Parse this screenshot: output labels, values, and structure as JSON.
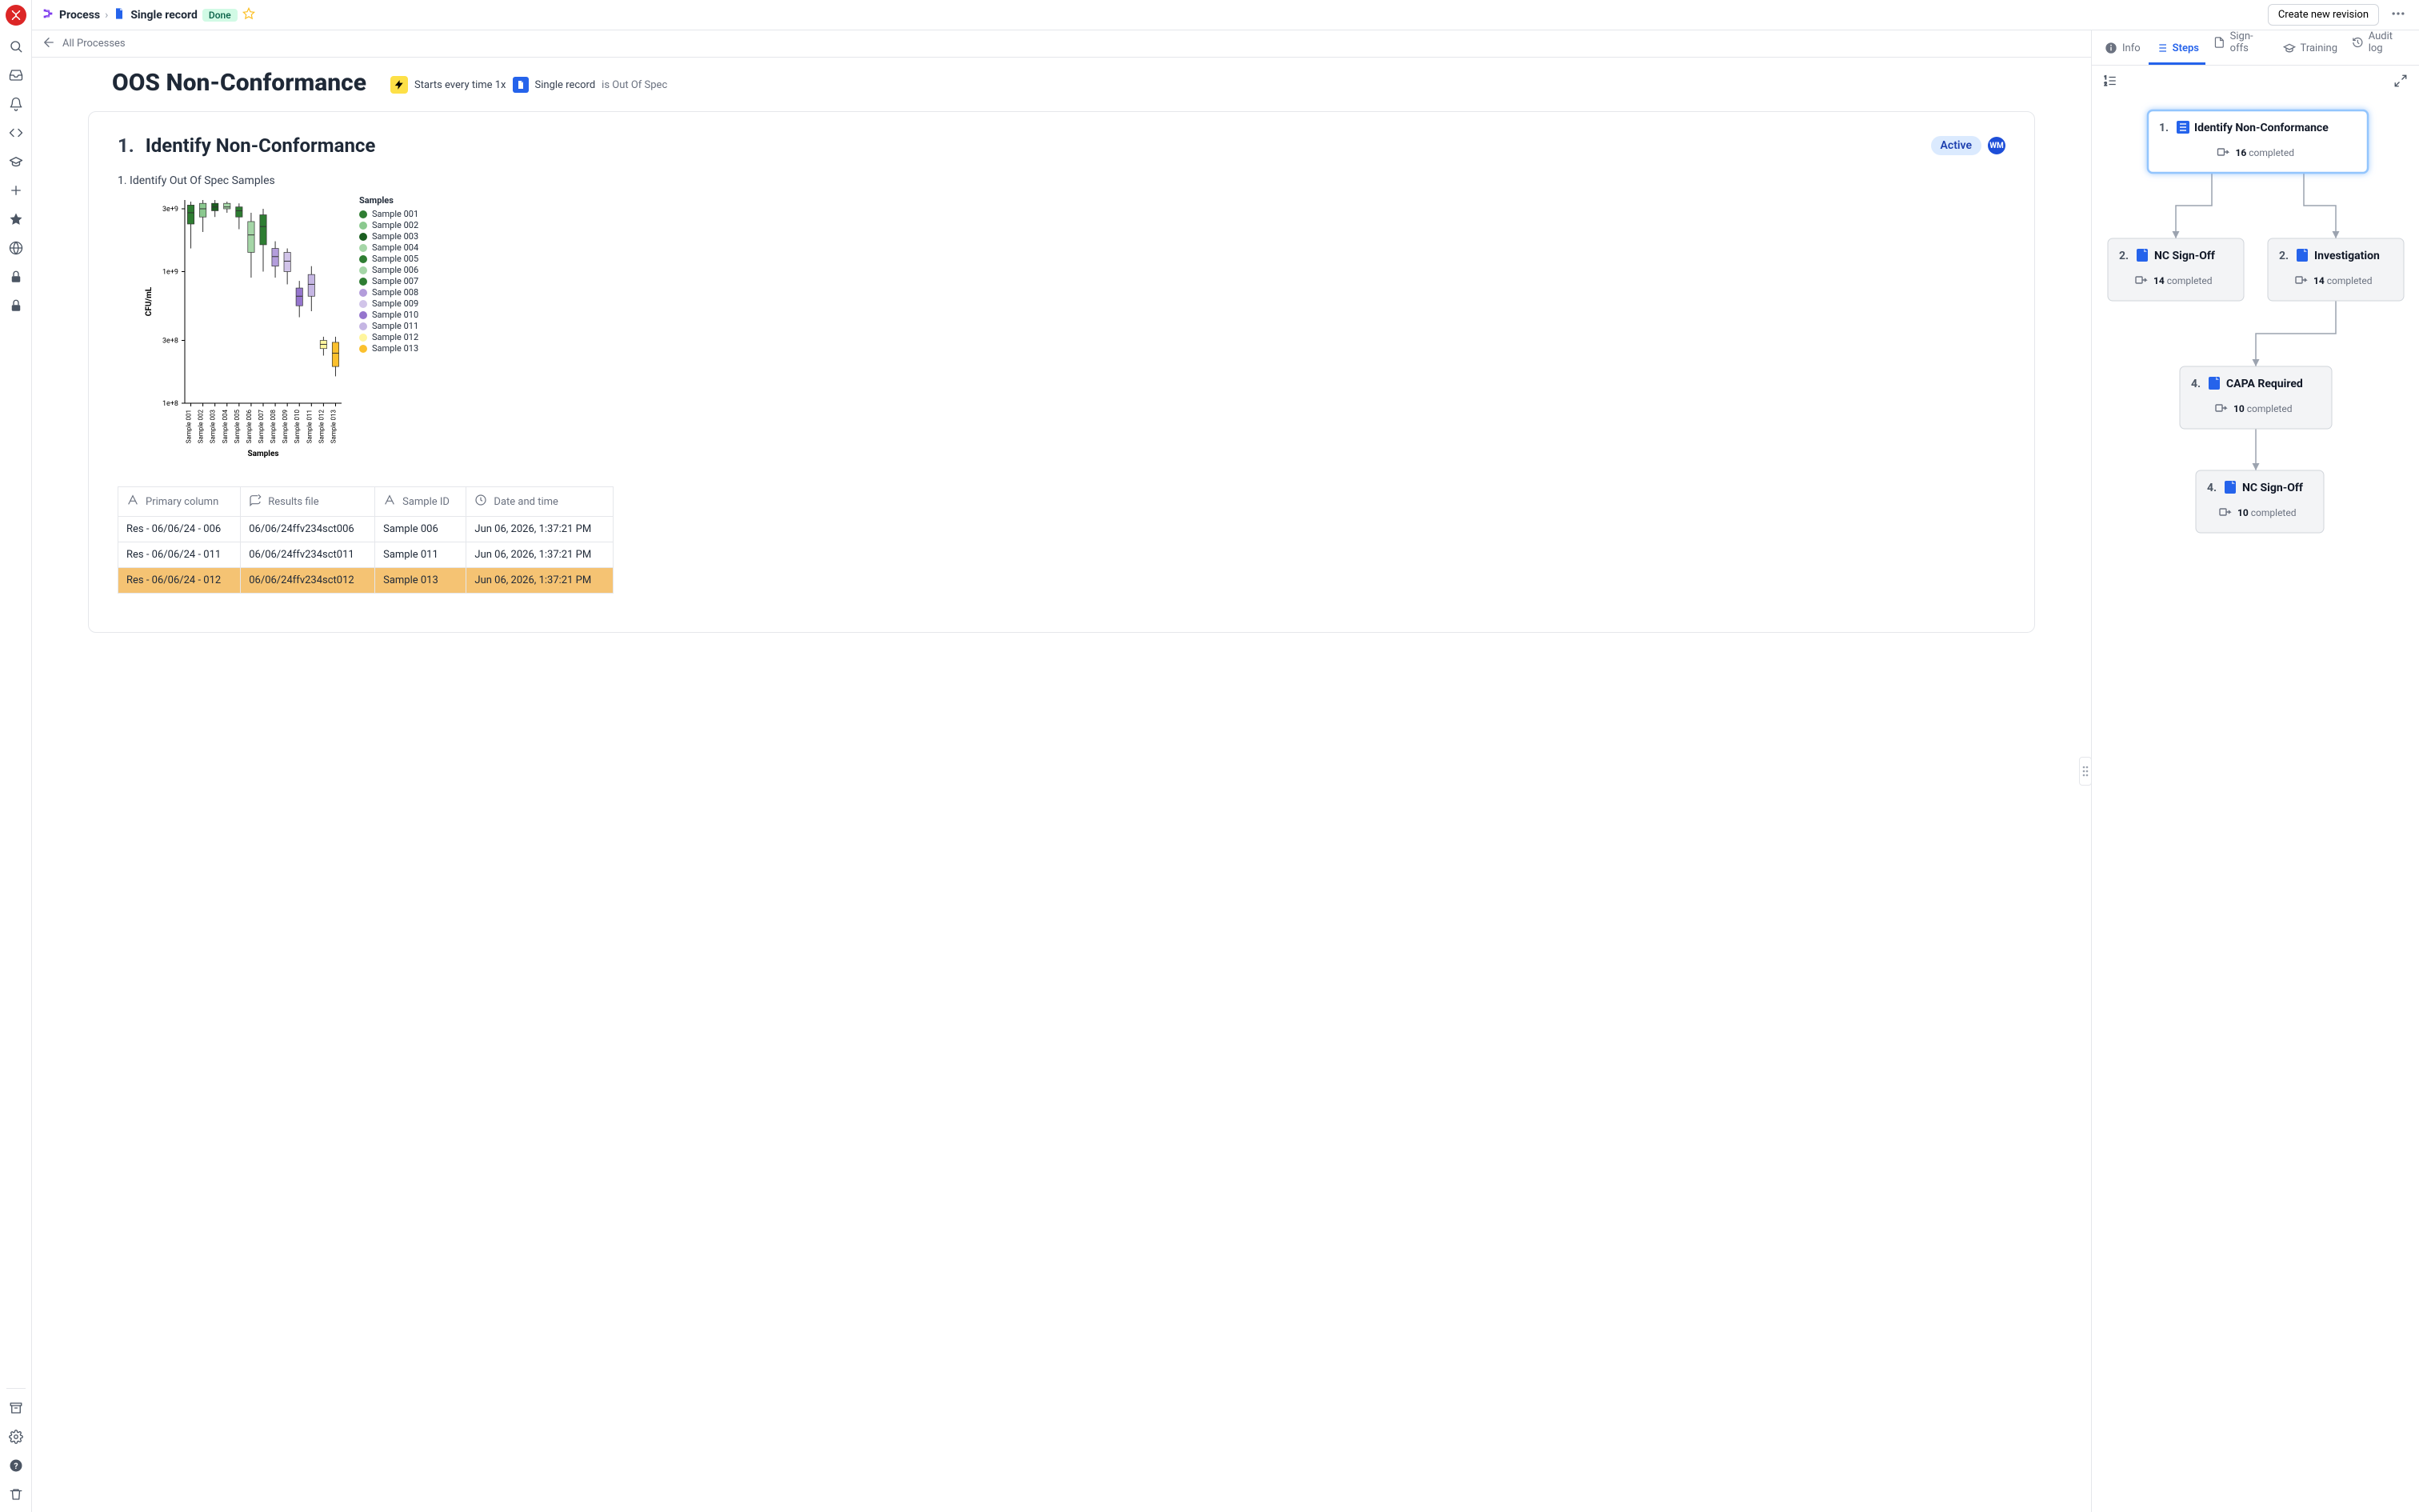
{
  "breadcrumb": {
    "item1": "Process",
    "item2": "Single record",
    "status": "Done"
  },
  "header_actions": {
    "create_revision": "Create new revision"
  },
  "backlink": "All Processes",
  "page_title": "OOS Non-Conformance",
  "trigger": {
    "prefix": "Starts every time 1x",
    "record": "Single record",
    "suffix": "is Out Of Spec"
  },
  "step": {
    "number": "1.",
    "title": "Identify Non-Conformance",
    "status": "Active",
    "avatar": "WM",
    "sub_title": "1. Identify Out Of Spec Samples"
  },
  "chart_data": {
    "type": "box",
    "title": "",
    "xlabel": "Samples",
    "ylabel": "CFU/mL",
    "yscale": "log",
    "yticks": [
      "1e+8",
      "3e+8",
      "1e+9",
      "3e+9"
    ],
    "legend_title": "Samples",
    "categories": [
      "Sample 001",
      "Sample 002",
      "Sample 003",
      "Sample 004",
      "Sample 005",
      "Sample 006",
      "Sample 007",
      "Sample 008",
      "Sample 009",
      "Sample 010",
      "Sample 011",
      "Sample 012",
      "Sample 013"
    ],
    "colors": [
      "#2f7d32",
      "#8bc98f",
      "#1b5e20",
      "#a5d6a7",
      "#2e7d32",
      "#a5d6a7",
      "#2e7d32",
      "#b39ddb",
      "#d1c4e9",
      "#9575cd",
      "#c5b6e3",
      "#fff59d",
      "#fbc02d"
    ],
    "series": [
      {
        "name": "Sample 001",
        "low": 1500000000.0,
        "q1": 2300000000.0,
        "median": 2800000000.0,
        "q3": 3200000000.0,
        "high": 3400000000.0
      },
      {
        "name": "Sample 002",
        "low": 2000000000.0,
        "q1": 2600000000.0,
        "median": 3000000000.0,
        "q3": 3300000000.0,
        "high": 3500000000.0
      },
      {
        "name": "Sample 003",
        "low": 2600000000.0,
        "q1": 2900000000.0,
        "median": 3100000000.0,
        "q3": 3300000000.0,
        "high": 3500000000.0
      },
      {
        "name": "Sample 004",
        "low": 2800000000.0,
        "q1": 3000000000.0,
        "median": 3100000000.0,
        "q3": 3300000000.0,
        "high": 3400000000.0
      },
      {
        "name": "Sample 005",
        "low": 2100000000.0,
        "q1": 2600000000.0,
        "median": 2900000000.0,
        "q3": 3100000000.0,
        "high": 3300000000.0
      },
      {
        "name": "Sample 006",
        "low": 900000000.0,
        "q1": 1400000000.0,
        "median": 1900000000.0,
        "q3": 2400000000.0,
        "high": 2800000000.0
      },
      {
        "name": "Sample 007",
        "low": 1000000000.0,
        "q1": 1600000000.0,
        "median": 2200000000.0,
        "q3": 2700000000.0,
        "high": 3000000000.0
      },
      {
        "name": "Sample 008",
        "low": 900000000.0,
        "q1": 1100000000.0,
        "median": 1300000000.0,
        "q3": 1500000000.0,
        "high": 1700000000.0
      },
      {
        "name": "Sample 009",
        "low": 800000000.0,
        "q1": 1000000000.0,
        "median": 1200000000.0,
        "q3": 1400000000.0,
        "high": 1500000000.0
      },
      {
        "name": "Sample 010",
        "low": 450000000.0,
        "q1": 550000000.0,
        "median": 650000000.0,
        "q3": 750000000.0,
        "high": 850000000.0
      },
      {
        "name": "Sample 011",
        "low": 500000000.0,
        "q1": 650000000.0,
        "median": 800000000.0,
        "q3": 950000000.0,
        "high": 1100000000.0
      },
      {
        "name": "Sample 012",
        "low": 230000000.0,
        "q1": 260000000.0,
        "median": 280000000.0,
        "q3": 300000000.0,
        "high": 320000000.0
      },
      {
        "name": "Sample 013",
        "low": 160000000.0,
        "q1": 190000000.0,
        "median": 240000000.0,
        "q3": 290000000.0,
        "high": 320000000.0
      }
    ]
  },
  "table": {
    "columns": [
      "Primary column",
      "Results file",
      "Sample ID",
      "Date and time"
    ],
    "rows": [
      {
        "primary": "Res - 06/06/24 - 006",
        "file": "06/06/24ffv234sct006",
        "sample": "Sample 006",
        "date": "Jun 06, 2026, 1:37:21 PM",
        "hl": false
      },
      {
        "primary": "Res - 06/06/24 - 011",
        "file": "06/06/24ffv234sct011",
        "sample": "Sample 011",
        "date": "Jun 06, 2026, 1:37:21 PM",
        "hl": false
      },
      {
        "primary": "Res - 06/06/24 - 012",
        "file": "06/06/24ffv234sct012",
        "sample": "Sample 013",
        "date": "Jun 06, 2026, 1:37:21 PM",
        "hl": true
      }
    ]
  },
  "side_tabs": {
    "info": "Info",
    "steps": "Steps",
    "signoffs": "Sign-offs",
    "training": "Training",
    "audit": "Audit log"
  },
  "flow": {
    "completed_label": "completed",
    "nodes": [
      {
        "num": "1.",
        "title": "Identify Non-Conformance",
        "count": "16",
        "active": true,
        "icon": "list"
      },
      {
        "num": "2.",
        "title": "NC Sign-Off",
        "count": "14",
        "active": false,
        "icon": "doc"
      },
      {
        "num": "2.",
        "title": "Investigation",
        "count": "14",
        "active": false,
        "icon": "doc"
      },
      {
        "num": "4.",
        "title": "CAPA Required",
        "count": "10",
        "active": false,
        "icon": "doc"
      },
      {
        "num": "4.",
        "title": "NC Sign-Off",
        "count": "10",
        "active": false,
        "icon": "doc"
      }
    ]
  }
}
